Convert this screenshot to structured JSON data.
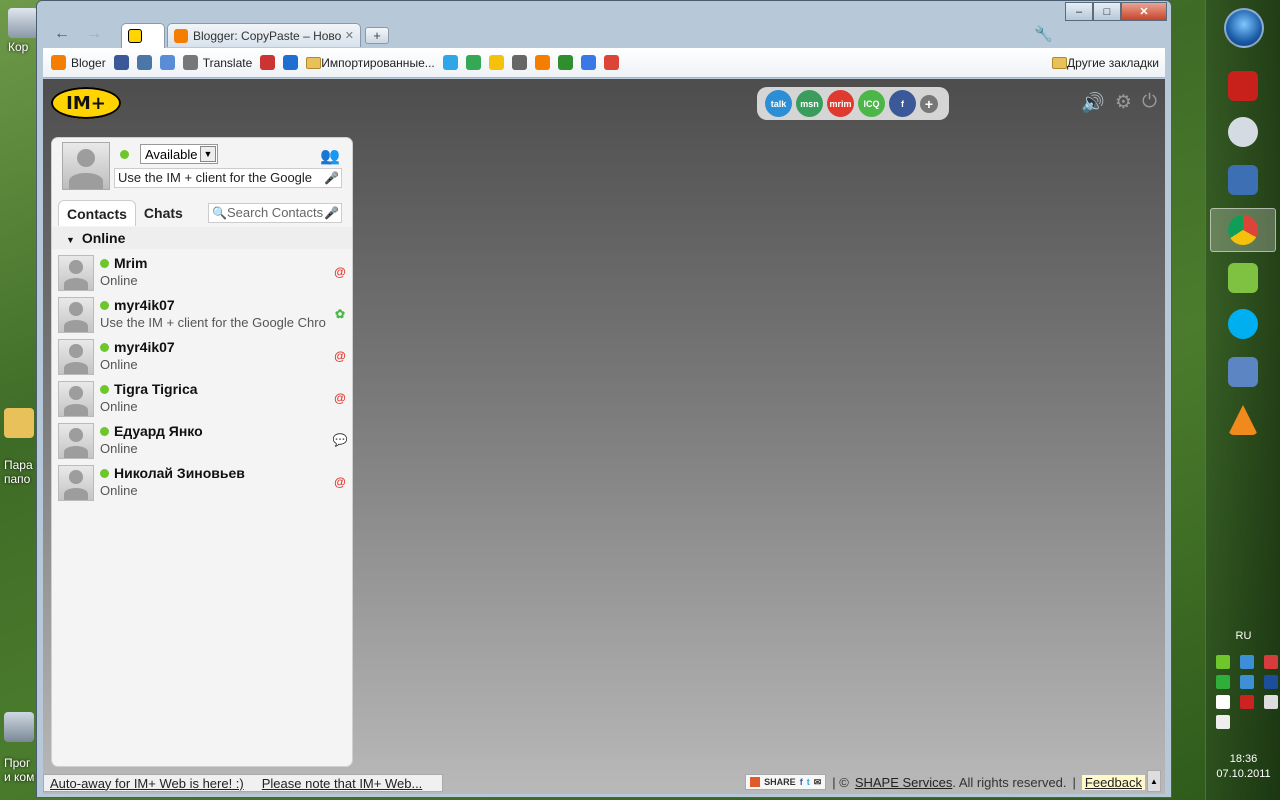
{
  "desktop": {
    "icons": [
      {
        "label": "Кор"
      },
      {
        "label": "Пара\nпапо"
      },
      {
        "label": "Прог\nи ком"
      }
    ]
  },
  "taskbar": {
    "language": "RU",
    "time": "18:36",
    "date": "07.10.2011"
  },
  "browser": {
    "tabs": [
      {
        "label": "",
        "active": true
      },
      {
        "label": "Blogger: CopyPaste – Ново",
        "active": false
      }
    ],
    "new_tab": "+",
    "bookmarks": [
      {
        "label": "Bloger",
        "color": "#f57d00"
      },
      {
        "label": "",
        "color": "#3b5998"
      },
      {
        "label": "",
        "color": "#4a76a8"
      },
      {
        "label": "",
        "color": "#5b8dd6"
      },
      {
        "label": "Translate",
        "color": "#777777"
      },
      {
        "label": "",
        "color": "#cc3333"
      },
      {
        "label": "",
        "color": "#1f6fd1"
      },
      {
        "label": "Импортированные...",
        "color": "#e8c15a",
        "folder": true
      },
      {
        "label": "",
        "color": "#2ea6e8"
      },
      {
        "label": "",
        "color": "#34a853"
      },
      {
        "label": "",
        "color": "#f4c20d"
      },
      {
        "label": "",
        "color": "#666666"
      },
      {
        "label": "",
        "color": "#f57d00"
      },
      {
        "label": "",
        "color": "#2f8f2f"
      },
      {
        "label": "",
        "color": "#3b78e7"
      },
      {
        "label": "",
        "color": "#db4437"
      }
    ],
    "other_bookmarks": "Другие закладки"
  },
  "app": {
    "logo": "IM+",
    "networks": [
      {
        "name": "talk",
        "color": "#2c8fd6"
      },
      {
        "name": "msn",
        "color": "#3a9d5d"
      },
      {
        "name": "mrim",
        "color": "#e03a2f"
      },
      {
        "name": "ICQ",
        "color": "#4cb648"
      },
      {
        "name": "f",
        "color": "#3b5998"
      }
    ],
    "add_network": "+",
    "panel": {
      "status_value": "Available",
      "status_message": "Use the IM + client for the Google",
      "tab_contacts": "Contacts",
      "tab_chats": "Chats",
      "search_placeholder": "Search Contacts",
      "group_name": "Online",
      "contacts": [
        {
          "name": "Mrim",
          "sub": "Online",
          "proto": "mrim"
        },
        {
          "name": "myr4ik07",
          "sub": "Use the IM + client for the Google Chro",
          "proto": "icq"
        },
        {
          "name": "myr4ik07",
          "sub": "Online",
          "proto": "mrim"
        },
        {
          "name": "Tigra Tigrica",
          "sub": "Online",
          "proto": "mrim"
        },
        {
          "name": "Едуард Янко",
          "sub": "Online",
          "proto": "chat"
        },
        {
          "name": "Николай Зиновьев",
          "sub": "Online",
          "proto": "mrim"
        }
      ]
    },
    "footer": {
      "news1": "Auto-away for IM+ Web is here! :)",
      "news2": "Please note that IM+ Web...",
      "share": "SHARE",
      "copyright_prefix": "| ©",
      "company": "SHAPE Services",
      "rights": ". All rights reserved.",
      "separator": "|",
      "feedback": "Feedback"
    }
  }
}
